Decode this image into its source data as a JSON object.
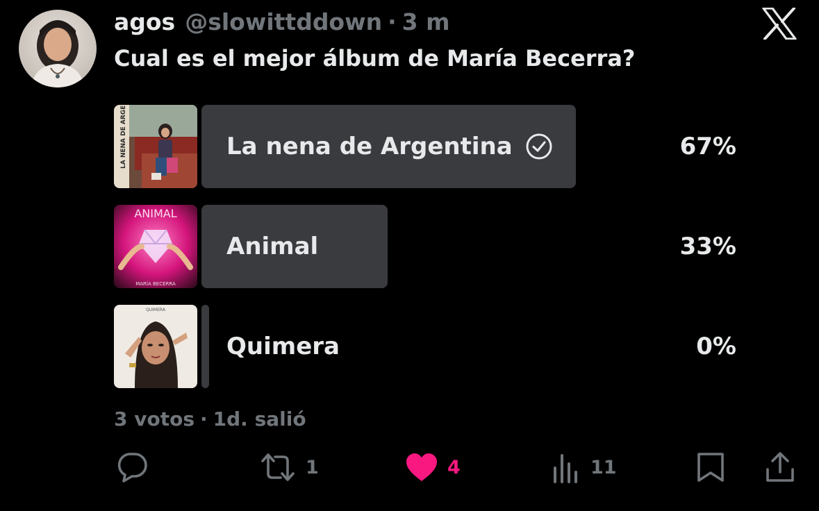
{
  "author": {
    "display_name": "agos",
    "handle": "@slowittddown",
    "separator": "·",
    "time": "3 m"
  },
  "tweet_text": "Cual es el mejor álbum de María Becerra?",
  "poll": {
    "options": [
      {
        "label": "La nena de Argentina",
        "percent_text": "67%",
        "percent": 67,
        "selected": true,
        "cover_text": "LA NENA DE ARGENTINA"
      },
      {
        "label": "Animal",
        "percent_text": "33%",
        "percent": 33,
        "selected": false,
        "cover_text": "ANIMAL",
        "cover_subtext": "MARÍA BECERRA"
      },
      {
        "label": "Quimera",
        "percent_text": "0%",
        "percent": 0,
        "selected": false,
        "cover_text": "QUIMERA"
      }
    ],
    "votes": "3 votos",
    "meta_separator": "·",
    "status": "1d. salió"
  },
  "actions": {
    "reply": {
      "icon": "reply-icon",
      "count": ""
    },
    "retweet": {
      "icon": "retweet-icon",
      "count": "1"
    },
    "like": {
      "icon": "heart-icon",
      "count": "4",
      "liked": true,
      "color": "#f91880"
    },
    "views": {
      "icon": "views-icon",
      "count": "11"
    },
    "bookmark": {
      "icon": "bookmark-icon"
    },
    "share": {
      "icon": "share-icon"
    }
  },
  "colors": {
    "background": "#000000",
    "text": "#e7e9ea",
    "muted": "#71767b",
    "poll_bar": "#3a3b3f",
    "like": "#f91880"
  }
}
